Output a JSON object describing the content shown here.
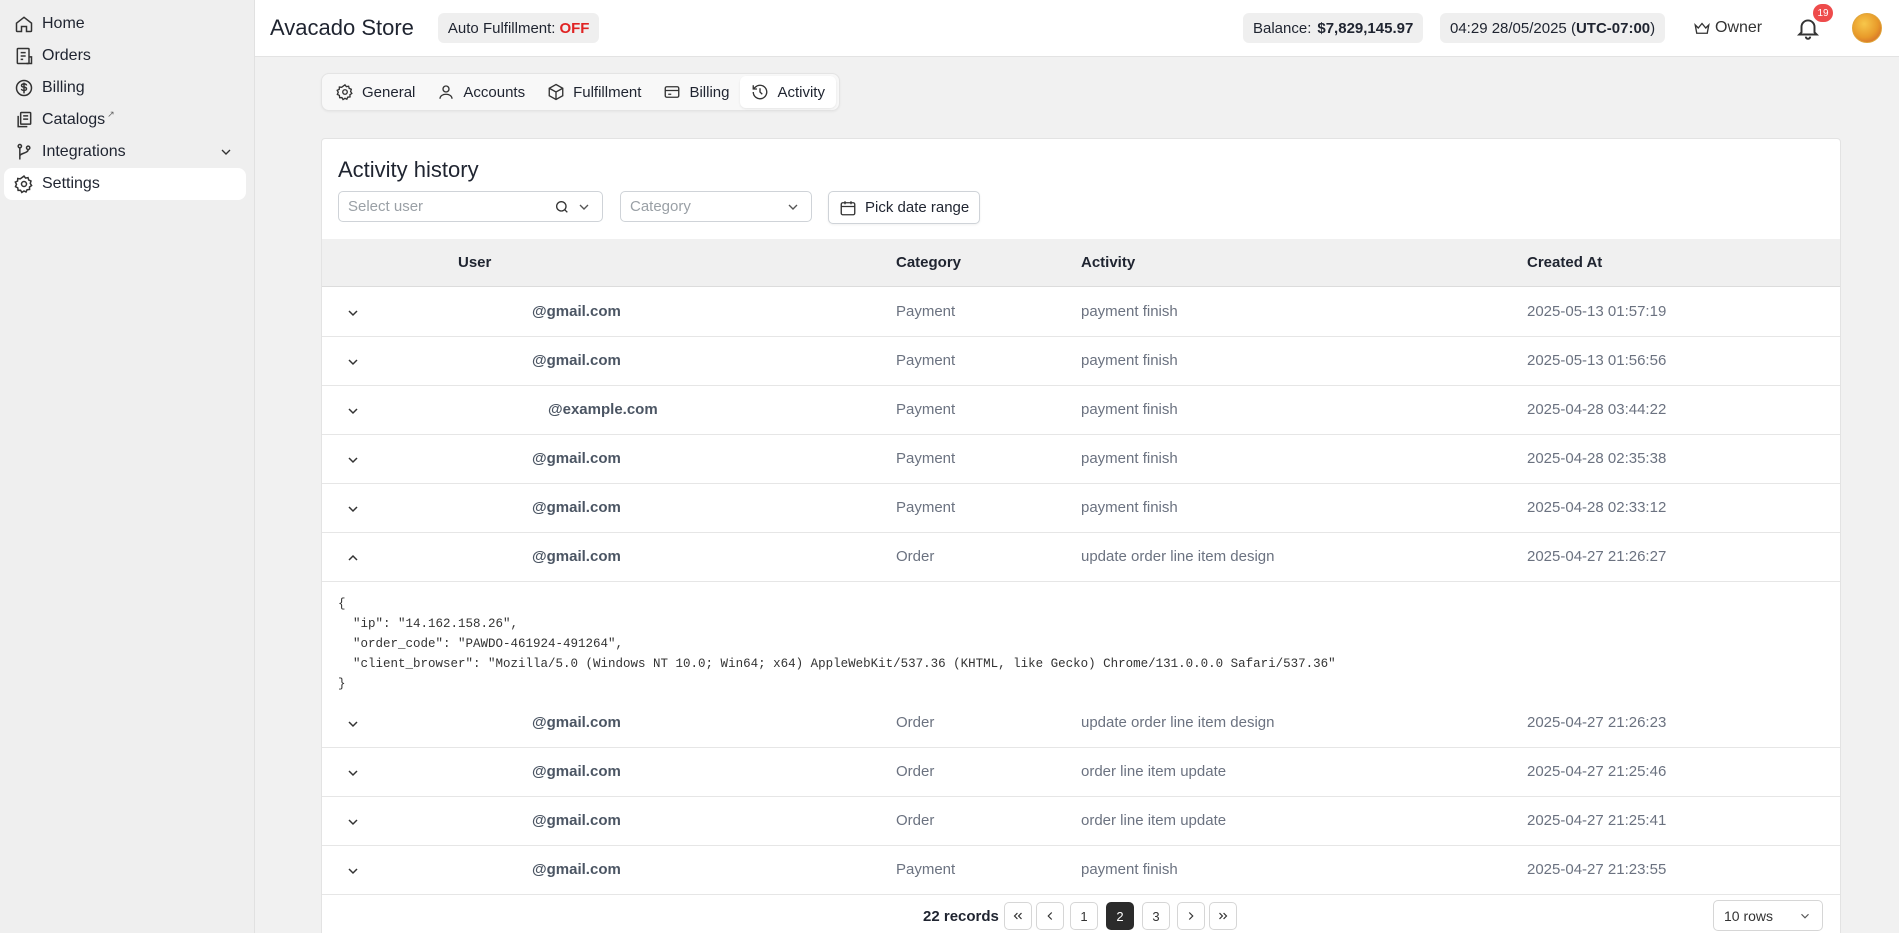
{
  "sidebar": {
    "items": [
      {
        "label": "Home",
        "icon": "home-icon"
      },
      {
        "label": "Orders",
        "icon": "orders-icon"
      },
      {
        "label": "Billing",
        "icon": "dollar-icon"
      },
      {
        "label": "Catalogs",
        "icon": "catalogs-icon",
        "ext": "↗"
      },
      {
        "label": "Integrations",
        "icon": "branch-icon"
      },
      {
        "label": "Settings",
        "icon": "gear-icon",
        "active": true
      }
    ]
  },
  "header": {
    "title": "Avacado Store",
    "auto_fulfillment_label": "Auto Fulfillment:",
    "auto_fulfillment_value": "OFF",
    "balance_label": "Balance:",
    "balance_value": "$7,829,145.97",
    "time": "04:29 28/05/2025 (",
    "timezone": "UTC-07:00",
    "time_close": ")",
    "role": "Owner",
    "notifications": "19"
  },
  "tabs": [
    {
      "label": "General",
      "icon": "gear-icon"
    },
    {
      "label": "Accounts",
      "icon": "user-icon"
    },
    {
      "label": "Fulfillment",
      "icon": "box-icon"
    },
    {
      "label": "Billing",
      "icon": "card-icon"
    },
    {
      "label": "Activity",
      "icon": "history-icon",
      "active": true
    }
  ],
  "activity": {
    "title": "Activity history",
    "user_placeholder": "Select user",
    "category_placeholder": "Category",
    "date_button": "Pick date range",
    "columns": [
      "User",
      "Category",
      "Activity",
      "Created At"
    ],
    "rows": [
      {
        "user": "@gmail.com",
        "category": "Payment",
        "activity": "payment finish",
        "created_at": "2025-05-13 01:57:19"
      },
      {
        "user": "@gmail.com",
        "category": "Payment",
        "activity": "payment finish",
        "created_at": "2025-05-13 01:56:56"
      },
      {
        "user": "@example.com",
        "category": "Payment",
        "activity": "payment finish",
        "created_at": "2025-04-28 03:44:22"
      },
      {
        "user": "@gmail.com",
        "category": "Payment",
        "activity": "payment finish",
        "created_at": "2025-04-28 02:35:38"
      },
      {
        "user": "@gmail.com",
        "category": "Payment",
        "activity": "payment finish",
        "created_at": "2025-04-28 02:33:12"
      },
      {
        "user": "@gmail.com",
        "category": "Order",
        "activity": "update order line item design",
        "created_at": "2025-04-27 21:26:27",
        "expanded": true
      },
      {
        "user": "@gmail.com",
        "category": "Order",
        "activity": "update order line item design",
        "created_at": "2025-04-27 21:26:23"
      },
      {
        "user": "@gmail.com",
        "category": "Order",
        "activity": "order line item update",
        "created_at": "2025-04-27 21:25:46"
      },
      {
        "user": "@gmail.com",
        "category": "Order",
        "activity": "order line item update",
        "created_at": "2025-04-27 21:25:41"
      },
      {
        "user": "@gmail.com",
        "category": "Payment",
        "activity": "payment finish",
        "created_at": "2025-04-27 21:23:55"
      }
    ],
    "expanded_detail": "{\n  \"ip\": \"14.162.158.26\",\n  \"order_code\": \"PAWDO-461924-491264\",\n  \"client_browser\": \"Mozilla/5.0 (Windows NT 10.0; Win64; x64) AppleWebKit/537.36 (KHTML, like Gecko) Chrome/131.0.0.0 Safari/537.36\"\n}"
  },
  "pagination": {
    "records": "22 records",
    "pages": [
      "1",
      "2",
      "3"
    ],
    "current_page": "2",
    "rows_per_page": "10 rows"
  }
}
